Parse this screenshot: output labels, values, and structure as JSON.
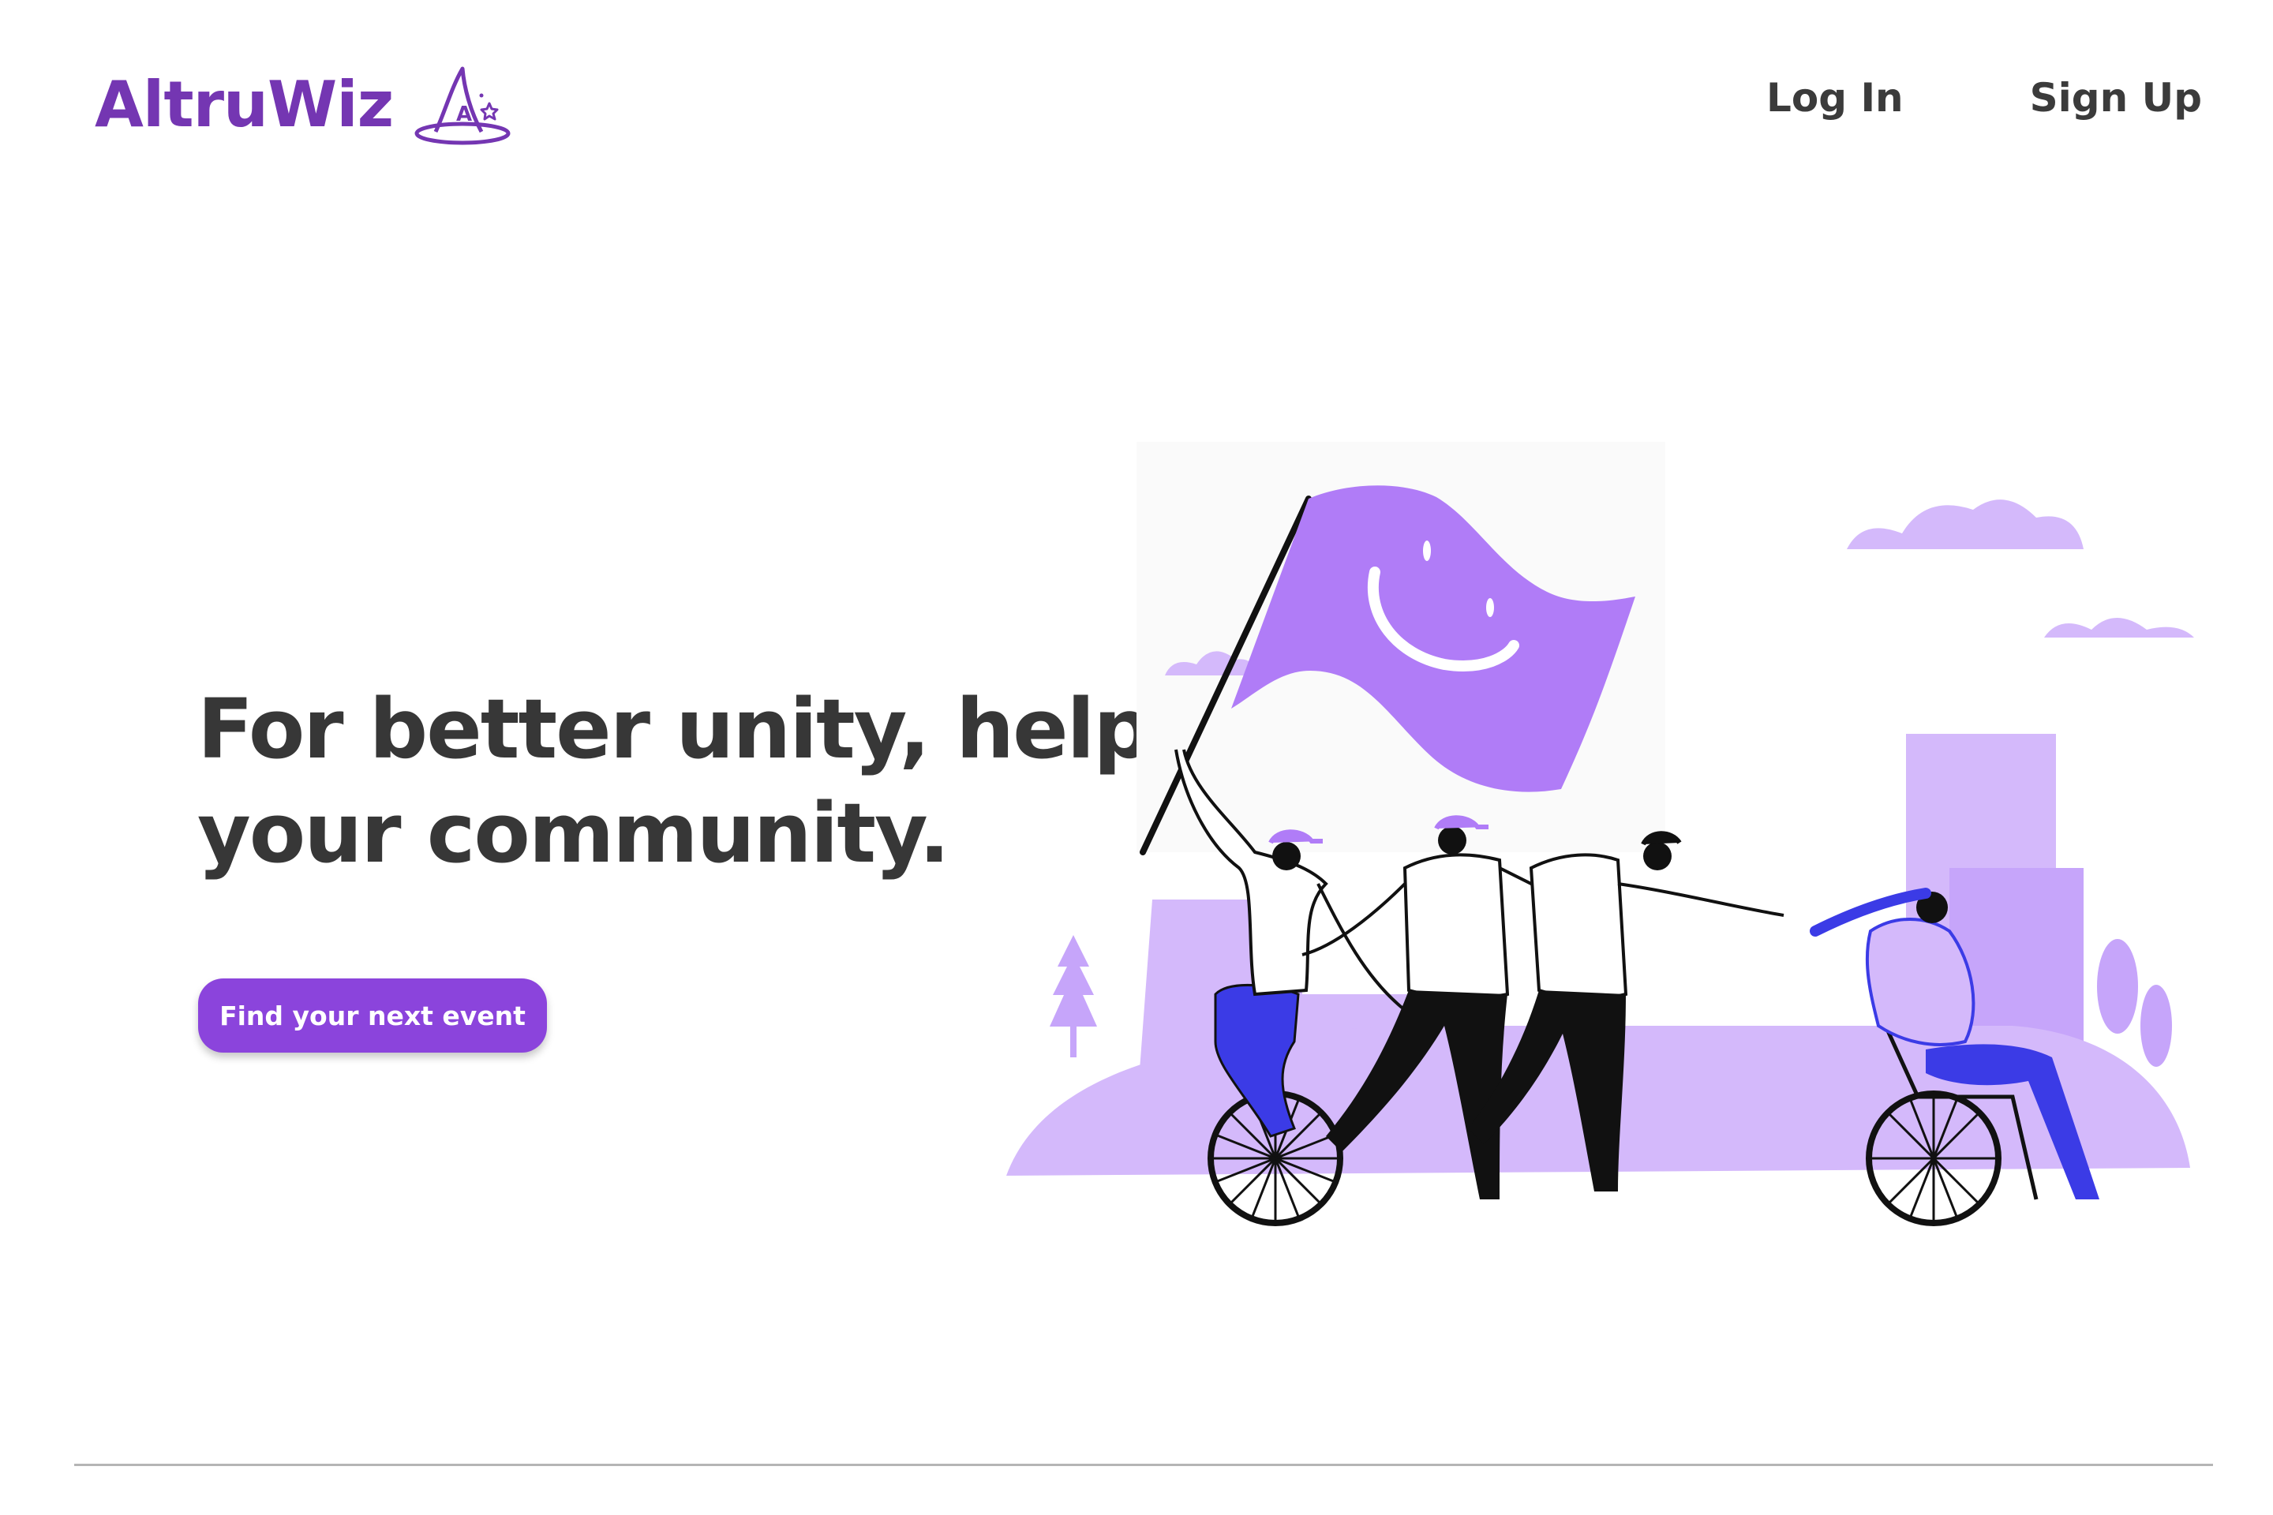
{
  "header": {
    "logo_text": "AltruWiz",
    "logo_icon": "wizard-hat-icon",
    "nav": {
      "login_label": "Log In",
      "signup_label": "Sign Up"
    }
  },
  "hero": {
    "title_line1": "For better unity, help",
    "title_line2": "your community.",
    "cta_label": "Find your next event",
    "illustration": "community-parade-illustration"
  },
  "colors": {
    "brand_purple": "#7436b2",
    "button_purple": "#8b44dc",
    "lavender": "#d4b9fb",
    "flag_purple": "#b07cf7",
    "accent_blue": "#3b3be6",
    "heading_text": "#373737",
    "nav_text": "#3b3b3b"
  }
}
